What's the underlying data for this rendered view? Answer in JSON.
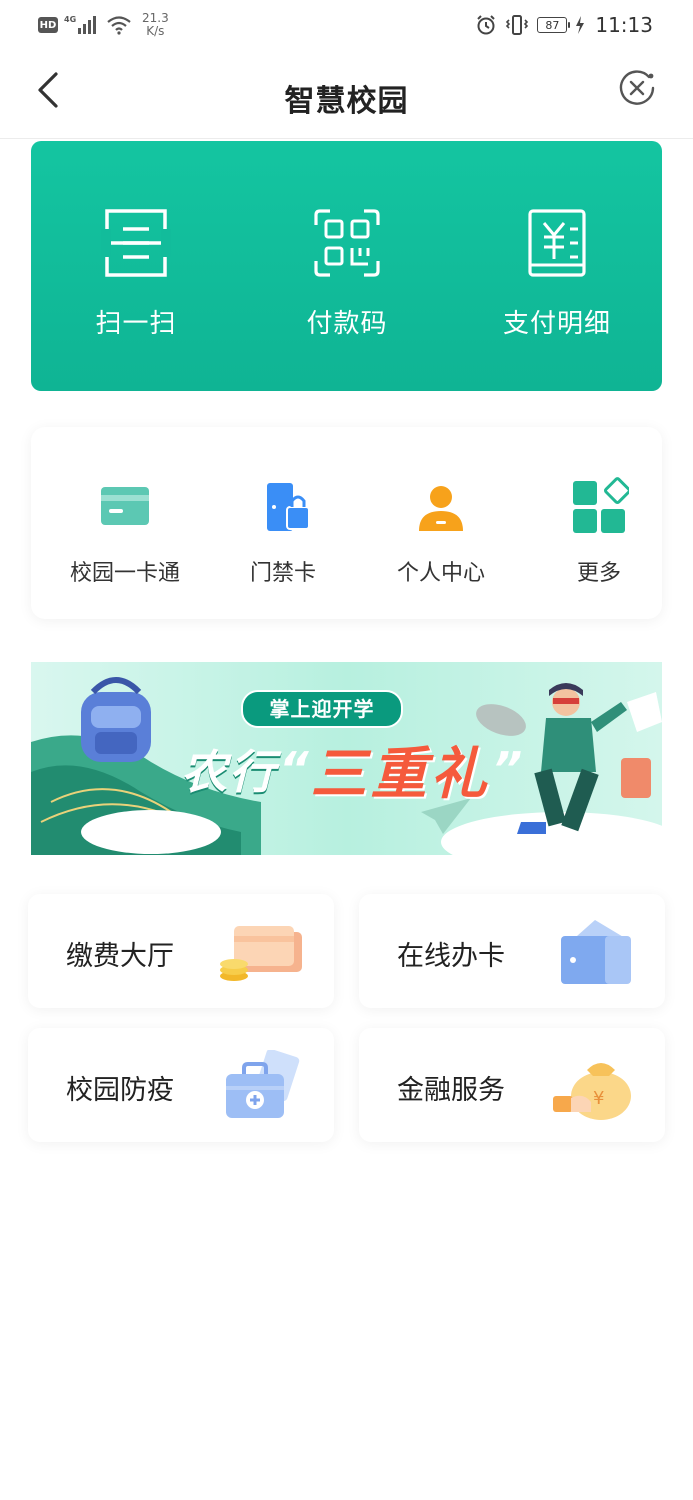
{
  "status_bar": {
    "hd": "HD",
    "network": "4G",
    "speed_value": "21.3",
    "speed_unit": "K/s",
    "battery": "87",
    "time": "11:13"
  },
  "header": {
    "title": "智慧校园"
  },
  "quick_actions": [
    {
      "label": "扫一扫",
      "icon": "scan-icon"
    },
    {
      "label": "付款码",
      "icon": "qr-code-icon"
    },
    {
      "label": "支付明细",
      "icon": "receipt-icon"
    }
  ],
  "services": [
    {
      "label": "校园一卡通",
      "icon": "card-icon"
    },
    {
      "label": "门禁卡",
      "icon": "door-lock-icon"
    },
    {
      "label": "个人中心",
      "icon": "user-icon"
    },
    {
      "label": "更多",
      "icon": "grid-more-icon"
    }
  ],
  "banner": {
    "pill_text": "掌上迎开学",
    "title_prefix": "农行",
    "quote_open": "“",
    "title_highlight": "三重礼",
    "quote_close": "”"
  },
  "tiles": [
    {
      "label": "缴费大厅",
      "icon": "payment-cards-icon"
    },
    {
      "label": "在线办卡",
      "icon": "wallet-card-icon"
    },
    {
      "label": "校园防疫",
      "icon": "medical-kit-icon"
    },
    {
      "label": "金融服务",
      "icon": "money-bag-icon"
    }
  ],
  "colors": {
    "primary_green": "#14c5a1",
    "accent_orange": "#f7a21b",
    "accent_blue": "#3a8ef6",
    "banner_red": "#f55a3c"
  }
}
